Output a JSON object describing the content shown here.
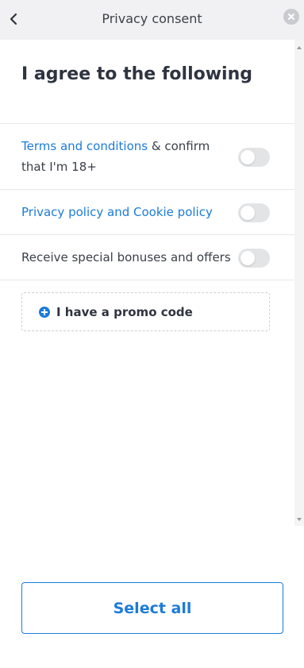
{
  "header": {
    "title": "Privacy consent",
    "back_icon": "chevron-left-icon",
    "close_icon": "close-icon"
  },
  "main": {
    "heading": "I agree to the following",
    "consents": [
      {
        "link_text": "Terms and conditions",
        "text": " & confirm that I'm 18+",
        "checked": false
      },
      {
        "link_text": "Privacy policy and Cookie policy",
        "text": "",
        "checked": false
      },
      {
        "link_text": "",
        "text": "Receive special bonuses and offers",
        "checked": false
      }
    ],
    "promo": {
      "label": "I have a promo code",
      "icon": "plus-circle-icon"
    }
  },
  "footer": {
    "select_all_label": "Select all"
  },
  "colors": {
    "accent": "#1c7bd8",
    "header_bg": "#f1f1f3",
    "toggle_off": "#e3e4e6"
  }
}
